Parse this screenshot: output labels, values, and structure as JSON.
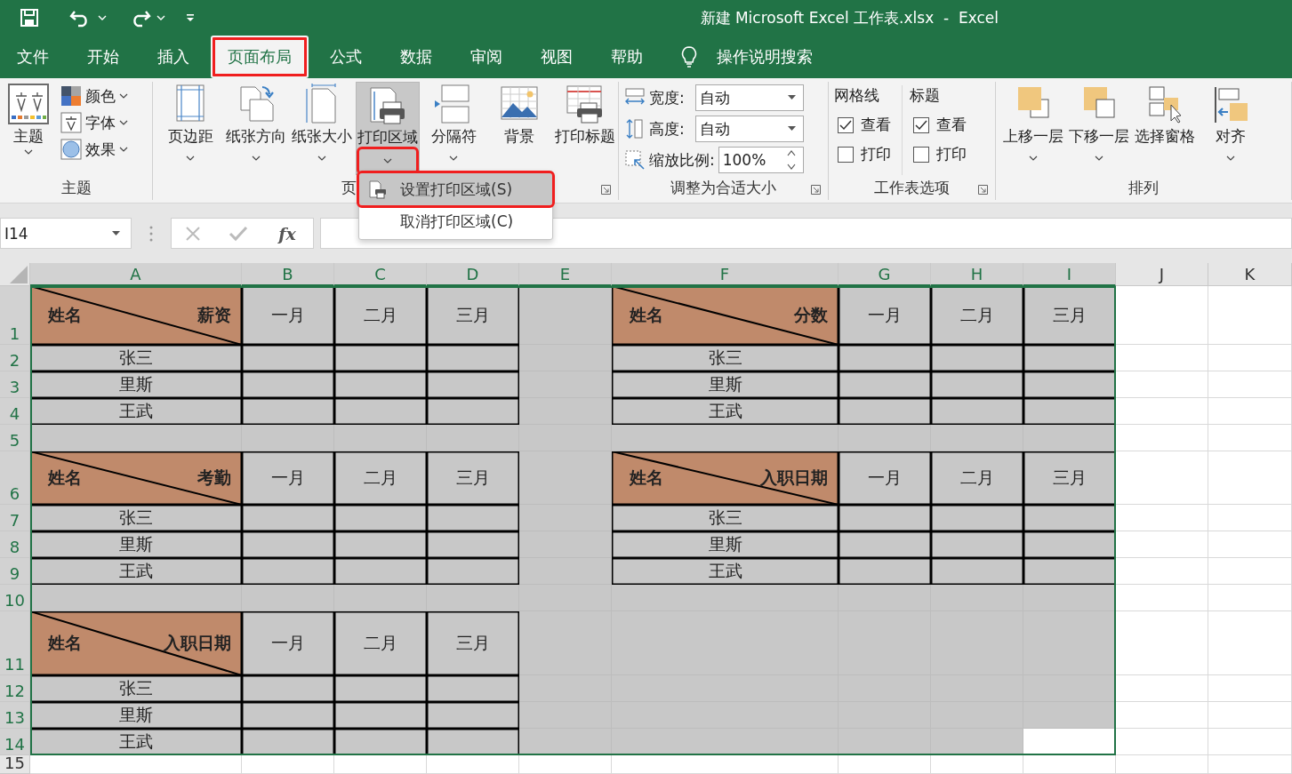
{
  "title_bar": {
    "title": "新建 Microsoft Excel 工作表.xlsx  -  Excel"
  },
  "tabs": [
    {
      "label": "文件",
      "selected": false,
      "annotated": false
    },
    {
      "label": "开始",
      "selected": false,
      "annotated": false
    },
    {
      "label": "插入",
      "selected": false,
      "annotated": false
    },
    {
      "label": "页面布局",
      "selected": true,
      "annotated": true
    },
    {
      "label": "公式",
      "selected": false,
      "annotated": false
    },
    {
      "label": "数据",
      "selected": false,
      "annotated": false
    },
    {
      "label": "审阅",
      "selected": false,
      "annotated": false
    },
    {
      "label": "视图",
      "selected": false,
      "annotated": false
    },
    {
      "label": "帮助",
      "selected": false,
      "annotated": false
    }
  ],
  "tell_me": "操作说明搜索",
  "ribbon": {
    "groups": [
      {
        "kind": "theme",
        "label": "主题",
        "launcher": false,
        "big": {
          "label": "主题"
        },
        "items": [
          {
            "label": "颜色"
          },
          {
            "label": "字体"
          },
          {
            "label": "效果"
          }
        ]
      },
      {
        "kind": "buttons",
        "label": "页",
        "launcher": true,
        "buttons": [
          {
            "label": "页边距",
            "dropdown": true,
            "pressed": false,
            "annotated": false
          },
          {
            "label": "纸张方向",
            "dropdown": true,
            "pressed": false,
            "annotated": false
          },
          {
            "label": "纸张大小",
            "dropdown": true,
            "pressed": false,
            "annotated": false
          },
          {
            "label": "打印区域",
            "dropdown": true,
            "pressed": true,
            "annotated": true
          },
          {
            "label": "分隔符",
            "dropdown": true,
            "pressed": false,
            "annotated": false
          },
          {
            "label": "背景",
            "dropdown": false,
            "pressed": false
          },
          {
            "label": "打印标题",
            "dropdown": false,
            "pressed": false
          }
        ]
      },
      {
        "kind": "fields",
        "label": "调整为合适大小",
        "launcher": true,
        "fields": [
          {
            "kind": "dropdown",
            "label": "宽度:",
            "value": "自动"
          },
          {
            "kind": "dropdown",
            "label": "高度:",
            "value": "自动"
          },
          {
            "kind": "spinner",
            "label": "缩放比例:",
            "value": "100%"
          }
        ]
      },
      {
        "kind": "options",
        "label": "工作表选项",
        "launcher": true,
        "columns": [
          {
            "heading": "网格线",
            "options": [
              {
                "label": "查看",
                "checked": true
              },
              {
                "label": "打印",
                "checked": false
              }
            ]
          },
          {
            "heading": "标题",
            "options": [
              {
                "label": "查看",
                "checked": true
              },
              {
                "label": "打印",
                "checked": false
              }
            ]
          }
        ]
      },
      {
        "kind": "buttons",
        "label": "排列",
        "launcher": false,
        "buttons": [
          {
            "label": "上移一层",
            "dropdown": true,
            "pressed": false,
            "annotated": false
          },
          {
            "label": "下移一层",
            "dropdown": true,
            "pressed": false,
            "annotated": false
          },
          {
            "label": "选择窗格",
            "dropdown": false,
            "pressed": false
          },
          {
            "label": "对齐",
            "dropdown": true,
            "pressed": false,
            "annotated": false
          }
        ]
      }
    ]
  },
  "print_area_menu": {
    "items": [
      {
        "label": "设置打印区域(S)",
        "selected": true,
        "annotated": true
      },
      {
        "label": "取消打印区域(C)",
        "selected": false,
        "annotated": false
      }
    ]
  },
  "formula_bar": {
    "name_box": "I14",
    "fx": "fx"
  },
  "sheet": {
    "columns": [
      {
        "label": "A",
        "selected": true
      },
      {
        "label": "B",
        "selected": true
      },
      {
        "label": "C",
        "selected": true
      },
      {
        "label": "D",
        "selected": true
      },
      {
        "label": "E",
        "selected": true
      },
      {
        "label": "F",
        "selected": true
      },
      {
        "label": "G",
        "selected": true
      },
      {
        "label": "H",
        "selected": true
      },
      {
        "label": "I",
        "selected": true
      },
      {
        "label": "J",
        "selected": false
      },
      {
        "label": "K",
        "selected": false
      }
    ],
    "rows": [
      {
        "number": "1",
        "selected": true,
        "cells": [
          {
            "kind": "corner",
            "left": "姓名",
            "right": "薪资"
          },
          {
            "kind": "table",
            "text": "一月"
          },
          {
            "kind": "table",
            "text": "二月"
          },
          {
            "kind": "table",
            "text": "三月"
          },
          {
            "kind": "fill"
          },
          {
            "kind": "corner",
            "left": "姓名",
            "right": "分数"
          },
          {
            "kind": "table",
            "text": "一月"
          },
          {
            "kind": "table",
            "text": "二月"
          },
          {
            "kind": "table",
            "text": "三月"
          },
          {
            "kind": "empty"
          },
          {
            "kind": "empty"
          }
        ]
      },
      {
        "number": "2",
        "selected": true,
        "cells": [
          {
            "kind": "table",
            "text": "张三"
          },
          {
            "kind": "table"
          },
          {
            "kind": "table"
          },
          {
            "kind": "table"
          },
          {
            "kind": "fill"
          },
          {
            "kind": "table",
            "text": "张三"
          },
          {
            "kind": "table"
          },
          {
            "kind": "table"
          },
          {
            "kind": "table"
          },
          {
            "kind": "empty"
          },
          {
            "kind": "empty"
          }
        ]
      },
      {
        "number": "3",
        "selected": true,
        "cells": [
          {
            "kind": "table",
            "text": "里斯"
          },
          {
            "kind": "table"
          },
          {
            "kind": "table"
          },
          {
            "kind": "table"
          },
          {
            "kind": "fill"
          },
          {
            "kind": "table",
            "text": "里斯"
          },
          {
            "kind": "table"
          },
          {
            "kind": "table"
          },
          {
            "kind": "table"
          },
          {
            "kind": "empty"
          },
          {
            "kind": "empty"
          }
        ]
      },
      {
        "number": "4",
        "selected": true,
        "cells": [
          {
            "kind": "table",
            "text": "王武"
          },
          {
            "kind": "table"
          },
          {
            "kind": "table"
          },
          {
            "kind": "table"
          },
          {
            "kind": "fill"
          },
          {
            "kind": "table",
            "text": "王武"
          },
          {
            "kind": "table"
          },
          {
            "kind": "table"
          },
          {
            "kind": "table"
          },
          {
            "kind": "empty"
          },
          {
            "kind": "empty"
          }
        ]
      },
      {
        "number": "5",
        "selected": true,
        "cells": [
          {
            "kind": "fill"
          },
          {
            "kind": "fill"
          },
          {
            "kind": "fill"
          },
          {
            "kind": "fill"
          },
          {
            "kind": "fill"
          },
          {
            "kind": "fill"
          },
          {
            "kind": "fill"
          },
          {
            "kind": "fill"
          },
          {
            "kind": "fill"
          },
          {
            "kind": "empty"
          },
          {
            "kind": "empty"
          }
        ]
      },
      {
        "number": "6",
        "selected": true,
        "cells": [
          {
            "kind": "corner",
            "left": "姓名",
            "right": "考勤"
          },
          {
            "kind": "table",
            "text": "一月"
          },
          {
            "kind": "table",
            "text": "二月"
          },
          {
            "kind": "table",
            "text": "三月"
          },
          {
            "kind": "fill"
          },
          {
            "kind": "corner",
            "left": "姓名",
            "right": "入职日期"
          },
          {
            "kind": "table",
            "text": "一月"
          },
          {
            "kind": "table",
            "text": "二月"
          },
          {
            "kind": "table",
            "text": "三月"
          },
          {
            "kind": "empty"
          },
          {
            "kind": "empty"
          }
        ]
      },
      {
        "number": "7",
        "selected": true,
        "cells": [
          {
            "kind": "table",
            "text": "张三"
          },
          {
            "kind": "table"
          },
          {
            "kind": "table"
          },
          {
            "kind": "table"
          },
          {
            "kind": "fill"
          },
          {
            "kind": "table",
            "text": "张三"
          },
          {
            "kind": "table"
          },
          {
            "kind": "table"
          },
          {
            "kind": "table"
          },
          {
            "kind": "empty"
          },
          {
            "kind": "empty"
          }
        ]
      },
      {
        "number": "8",
        "selected": true,
        "cells": [
          {
            "kind": "table",
            "text": "里斯"
          },
          {
            "kind": "table"
          },
          {
            "kind": "table"
          },
          {
            "kind": "table"
          },
          {
            "kind": "fill"
          },
          {
            "kind": "table",
            "text": "里斯"
          },
          {
            "kind": "table"
          },
          {
            "kind": "table"
          },
          {
            "kind": "table"
          },
          {
            "kind": "empty"
          },
          {
            "kind": "empty"
          }
        ]
      },
      {
        "number": "9",
        "selected": true,
        "cells": [
          {
            "kind": "table",
            "text": "王武"
          },
          {
            "kind": "table"
          },
          {
            "kind": "table"
          },
          {
            "kind": "table"
          },
          {
            "kind": "fill"
          },
          {
            "kind": "table",
            "text": "王武"
          },
          {
            "kind": "table"
          },
          {
            "kind": "table"
          },
          {
            "kind": "table"
          },
          {
            "kind": "empty"
          },
          {
            "kind": "empty"
          }
        ]
      },
      {
        "number": "10",
        "selected": true,
        "cells": [
          {
            "kind": "fill"
          },
          {
            "kind": "fill"
          },
          {
            "kind": "fill"
          },
          {
            "kind": "fill"
          },
          {
            "kind": "fill"
          },
          {
            "kind": "fill"
          },
          {
            "kind": "fill"
          },
          {
            "kind": "fill"
          },
          {
            "kind": "fill"
          },
          {
            "kind": "empty"
          },
          {
            "kind": "empty"
          }
        ]
      },
      {
        "number": "11",
        "selected": true,
        "cells": [
          {
            "kind": "corner",
            "left": "姓名",
            "right": "入职日期"
          },
          {
            "kind": "table",
            "text": "一月"
          },
          {
            "kind": "table",
            "text": "二月"
          },
          {
            "kind": "table",
            "text": "三月"
          },
          {
            "kind": "fill"
          },
          {
            "kind": "fill"
          },
          {
            "kind": "fill"
          },
          {
            "kind": "fill"
          },
          {
            "kind": "fill"
          },
          {
            "kind": "empty"
          },
          {
            "kind": "empty"
          }
        ]
      },
      {
        "number": "12",
        "selected": true,
        "cells": [
          {
            "kind": "table",
            "text": "张三"
          },
          {
            "kind": "table"
          },
          {
            "kind": "table"
          },
          {
            "kind": "table"
          },
          {
            "kind": "fill"
          },
          {
            "kind": "fill"
          },
          {
            "kind": "fill"
          },
          {
            "kind": "fill"
          },
          {
            "kind": "fill"
          },
          {
            "kind": "empty"
          },
          {
            "kind": "empty"
          }
        ]
      },
      {
        "number": "13",
        "selected": true,
        "cells": [
          {
            "kind": "table",
            "text": "里斯"
          },
          {
            "kind": "table"
          },
          {
            "kind": "table"
          },
          {
            "kind": "table"
          },
          {
            "kind": "fill"
          },
          {
            "kind": "fill"
          },
          {
            "kind": "fill"
          },
          {
            "kind": "fill"
          },
          {
            "kind": "fill"
          },
          {
            "kind": "empty"
          },
          {
            "kind": "empty"
          }
        ]
      },
      {
        "number": "14",
        "selected": true,
        "cells": [
          {
            "kind": "table",
            "text": "王武"
          },
          {
            "kind": "table"
          },
          {
            "kind": "table"
          },
          {
            "kind": "table"
          },
          {
            "kind": "fill"
          },
          {
            "kind": "fill"
          },
          {
            "kind": "fill"
          },
          {
            "kind": "fill"
          },
          {
            "kind": "active"
          },
          {
            "kind": "empty"
          },
          {
            "kind": "empty"
          }
        ]
      },
      {
        "number": "15",
        "selected": false,
        "cells": [
          {
            "kind": "empty"
          },
          {
            "kind": "empty"
          },
          {
            "kind": "empty"
          },
          {
            "kind": "empty"
          },
          {
            "kind": "empty"
          },
          {
            "kind": "empty"
          },
          {
            "kind": "empty"
          },
          {
            "kind": "empty"
          },
          {
            "kind": "empty"
          },
          {
            "kind": "empty"
          },
          {
            "kind": "empty"
          }
        ]
      }
    ]
  }
}
